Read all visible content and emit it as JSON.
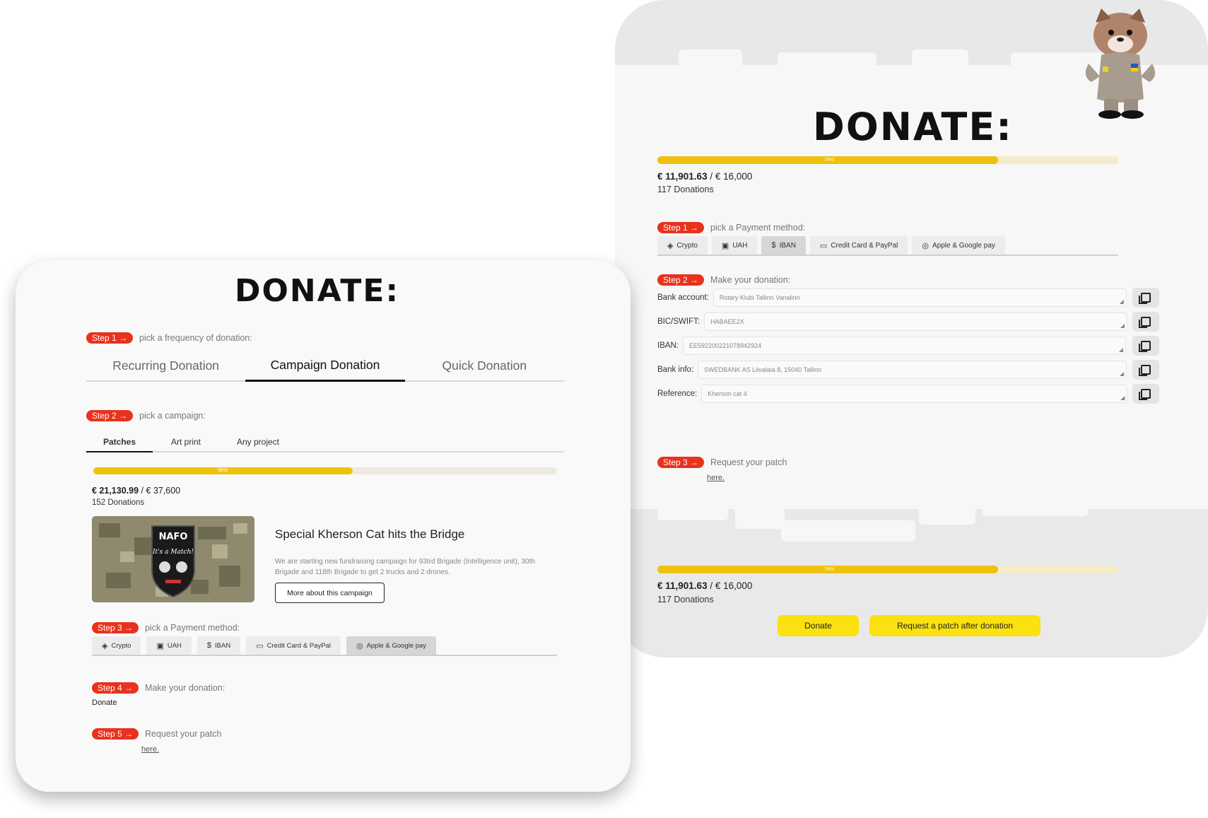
{
  "right": {
    "title": "DONATE:",
    "progress": {
      "percent_label": "74%",
      "fraction": 0.74
    },
    "amount_raised": "€ 11,901.63",
    "amount_sep_goal": " / € 16,000",
    "donations": "117 Donations",
    "step1": {
      "pill": "Step 1 →",
      "text": "pick a Payment method:"
    },
    "payment_tabs": [
      {
        "label": "Crypto",
        "icon": "crypto-icon"
      },
      {
        "label": "UAH",
        "icon": "cash-icon"
      },
      {
        "label": "IBAN",
        "icon": "dollar-icon"
      },
      {
        "label": "Credit Card & PayPal",
        "icon": "card-icon"
      },
      {
        "label": "Apple & Google pay",
        "icon": "wallet-icon"
      }
    ],
    "active_payment": "IBAN",
    "step2": {
      "pill": "Step 2 →",
      "text": "Make your donation:"
    },
    "fields": [
      {
        "label": "Bank account:",
        "value": "Rotary Klubi Tallinn Vanalinn"
      },
      {
        "label": "BIC/SWIFT:",
        "value": "HABAEE2X"
      },
      {
        "label": "IBAN:",
        "value": "EE592200221078942924"
      },
      {
        "label": "Bank info:",
        "value": "SWEDBANK AS Liivalaia 8, 15040 Tallinn"
      },
      {
        "label": "Reference:",
        "value": "Kherson cat 4"
      }
    ],
    "step3": {
      "pill": "Step 3 →",
      "text": "Request your patch",
      "link": "here."
    },
    "bottom": {
      "progress": {
        "percent_label": "74%",
        "fraction": 0.74
      },
      "amount_raised": "€ 11,901.63",
      "amount_sep_goal": " / € 16,000",
      "donations": "117 Donations",
      "donate_button": "Donate",
      "request_button": "Request a patch after donation"
    }
  },
  "left": {
    "title": "DONATE:",
    "step1": {
      "pill": "Step 1 →",
      "text": "pick a frequency of donation:"
    },
    "frequency_tabs": [
      "Recurring Donation",
      "Campaign Donation",
      "Quick Donation"
    ],
    "active_frequency": "Campaign Donation",
    "step2": {
      "pill": "Step 2 →",
      "text": "pick a campaign:"
    },
    "campaign_tabs": [
      "Patches",
      "Art print",
      "Any project"
    ],
    "active_campaign": "Patches",
    "progress": {
      "percent_label": "56%",
      "fraction": 0.56
    },
    "amount_raised": "€ 21,130.99",
    "amount_sep_goal": " / € 37,600",
    "donations": "152 Donations",
    "campaign": {
      "patch_text_top": "NAFO",
      "patch_text_mid": "It's a Match!",
      "title": "Special Kherson Cat hits the Bridge",
      "description": "We are starting new fundraising campaign for 93trd Brigade (Intelligence unit), 30th Brigade and 118th Brigade to get 2 trucks and 2 drones.",
      "button": "More about this campaign"
    },
    "step3": {
      "pill": "Step 3 →",
      "text": "pick a Payment method:"
    },
    "payment_tabs": [
      {
        "label": "Crypto",
        "icon": "crypto-icon"
      },
      {
        "label": "UAH",
        "icon": "cash-icon"
      },
      {
        "label": "IBAN",
        "icon": "dollar-icon"
      },
      {
        "label": "Credit Card & PayPal",
        "icon": "card-icon"
      },
      {
        "label": "Apple & Google pay",
        "icon": "wallet-icon"
      }
    ],
    "active_payment": "Apple & Google pay",
    "step4": {
      "pill": "Step 4 →",
      "text": "Make your donation:",
      "value": "Donate"
    },
    "step5": {
      "pill": "Step 5 →",
      "text": "Request your patch",
      "link": "here."
    }
  },
  "colors": {
    "accent_red": "#e8321e",
    "progress_yellow": "#eec20c",
    "button_yellow": "#fbe10f",
    "track": "#f5edc9"
  }
}
